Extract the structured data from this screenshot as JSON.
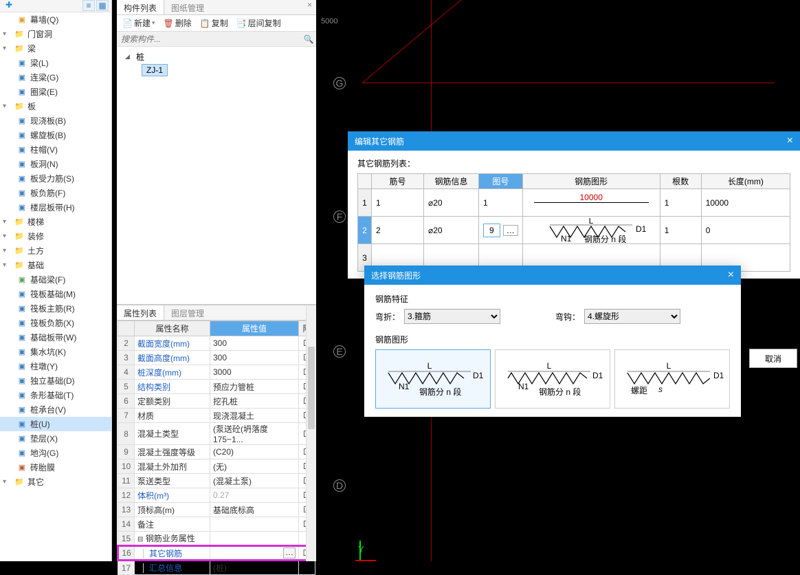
{
  "left_tree": {
    "categories": [
      {
        "label": "幕墙(Q)",
        "indent": "sub",
        "icon": "wall",
        "color": "#e0a030"
      },
      {
        "label": "门窗洞",
        "indent": "top",
        "icon": "folder"
      },
      {
        "label": "梁",
        "indent": "top",
        "icon": "folder"
      },
      {
        "label": "梁(L)",
        "indent": "sub",
        "icon": "beam",
        "color": "#4080c0"
      },
      {
        "label": "连梁(G)",
        "indent": "sub",
        "icon": "beam",
        "color": "#4080c0"
      },
      {
        "label": "圈梁(E)",
        "indent": "sub",
        "icon": "beam",
        "color": "#4080c0"
      },
      {
        "label": "板",
        "indent": "top",
        "icon": "folder"
      },
      {
        "label": "现浇板(B)",
        "indent": "sub",
        "icon": "slab",
        "color": "#4080c0"
      },
      {
        "label": "螺旋板(B)",
        "indent": "sub",
        "icon": "slab",
        "color": "#4080c0"
      },
      {
        "label": "柱帽(V)",
        "indent": "sub",
        "icon": "cap",
        "color": "#4080c0"
      },
      {
        "label": "板洞(N)",
        "indent": "sub",
        "icon": "hole",
        "color": "#4080c0"
      },
      {
        "label": "板受力筋(S)",
        "indent": "sub",
        "icon": "rebar",
        "color": "#4080c0"
      },
      {
        "label": "板负筋(F)",
        "indent": "sub",
        "icon": "rebar",
        "color": "#4080c0"
      },
      {
        "label": "楼层板带(H)",
        "indent": "sub",
        "icon": "strip",
        "color": "#4080c0"
      },
      {
        "label": "楼梯",
        "indent": "top",
        "icon": "folder"
      },
      {
        "label": "装修",
        "indent": "top",
        "icon": "folder"
      },
      {
        "label": "土方",
        "indent": "top",
        "icon": "folder"
      },
      {
        "label": "基础",
        "indent": "top",
        "icon": "folder"
      },
      {
        "label": "基础梁(F)",
        "indent": "sub",
        "icon": "fbeam",
        "color": "#60a060"
      },
      {
        "label": "筏板基础(M)",
        "indent": "sub",
        "icon": "raft",
        "color": "#4080c0"
      },
      {
        "label": "筏板主筋(R)",
        "indent": "sub",
        "icon": "rebar",
        "color": "#4080c0"
      },
      {
        "label": "筏板负筋(X)",
        "indent": "sub",
        "icon": "rebar",
        "color": "#4080c0"
      },
      {
        "label": "基础板带(W)",
        "indent": "sub",
        "icon": "strip",
        "color": "#4080c0"
      },
      {
        "label": "集水坑(K)",
        "indent": "sub",
        "icon": "sump",
        "color": "#4080c0"
      },
      {
        "label": "柱墩(Y)",
        "indent": "sub",
        "icon": "pier",
        "color": "#4080c0"
      },
      {
        "label": "独立基础(D)",
        "indent": "sub",
        "icon": "iso",
        "color": "#4080c0"
      },
      {
        "label": "条形基础(T)",
        "indent": "sub",
        "icon": "strip2",
        "color": "#4080c0"
      },
      {
        "label": "桩承台(V)",
        "indent": "sub",
        "icon": "cap2",
        "color": "#4080c0"
      },
      {
        "label": "桩(U)",
        "indent": "sub",
        "icon": "pile",
        "color": "#4080c0",
        "selected": true
      },
      {
        "label": "垫层(X)",
        "indent": "sub",
        "icon": "bed",
        "color": "#4080c0"
      },
      {
        "label": "地沟(G)",
        "indent": "sub",
        "icon": "trench",
        "color": "#4080c0"
      },
      {
        "label": "砖胎膜",
        "indent": "sub",
        "icon": "brick",
        "color": "#c06030"
      },
      {
        "label": "其它",
        "indent": "top",
        "icon": "folder"
      }
    ]
  },
  "component_panel": {
    "tabs": [
      "构件列表",
      "图纸管理"
    ],
    "toolbar": {
      "new": "新建",
      "delete": "删除",
      "copy": "复制",
      "layer_copy": "层间复制"
    },
    "search_placeholder": "搜索构件...",
    "tree": [
      {
        "label": "桩",
        "level": 0
      },
      {
        "label": "ZJ-1",
        "level": 1,
        "selected": true
      }
    ]
  },
  "property_panel": {
    "tabs": [
      "属性列表",
      "图层管理"
    ],
    "headers": {
      "name": "属性名称",
      "value": "属性值",
      "extra": "附"
    },
    "rows": [
      {
        "n": "2",
        "name": "截面宽度(mm)",
        "value": "300",
        "link": true
      },
      {
        "n": "3",
        "name": "截面高度(mm)",
        "value": "300",
        "link": true
      },
      {
        "n": "4",
        "name": "桩深度(mm)",
        "value": "3000",
        "link": true
      },
      {
        "n": "5",
        "name": "结构类别",
        "value": "预应力管桩",
        "link": true
      },
      {
        "n": "6",
        "name": "定额类别",
        "value": "挖孔桩"
      },
      {
        "n": "7",
        "name": "材质",
        "value": "现浇混凝土"
      },
      {
        "n": "8",
        "name": "混凝土类型",
        "value": "(泵送砼(坍落度175~1..."
      },
      {
        "n": "9",
        "name": "混凝土强度等级",
        "value": "(C20)"
      },
      {
        "n": "10",
        "name": "混凝土外加剂",
        "value": "(无)"
      },
      {
        "n": "11",
        "name": "泵送类型",
        "value": "(混凝土泵)"
      },
      {
        "n": "12",
        "name": "体积(m³)",
        "value": "0.27",
        "gray": true,
        "link": true
      },
      {
        "n": "13",
        "name": "顶标高(m)",
        "value": "基础底标高"
      },
      {
        "n": "14",
        "name": "备注",
        "value": ""
      },
      {
        "n": "15",
        "name": "钢筋业务属性",
        "value": "",
        "group": true
      },
      {
        "n": "16",
        "name": "其它钢筋",
        "value": "",
        "highlight": true,
        "link": true,
        "ellipsis": true
      },
      {
        "n": "17",
        "name": "汇总信息",
        "value": "(桩)",
        "link": true
      }
    ]
  },
  "canvas": {
    "dim1": "5000",
    "labels": [
      "G",
      "F",
      "E",
      "D"
    ],
    "coord_y": "Y"
  },
  "dlg_edit": {
    "title": "编辑其它钢筋",
    "list_label": "其它钢筋列表：",
    "headers": [
      "筋号",
      "钢筋信息",
      "图号",
      "钢筋图形",
      "根数",
      "长度(mm)"
    ],
    "rows": [
      {
        "n": "1",
        "id": "1",
        "info": "⌀20",
        "shape_no": "1",
        "shape_dim": "10000",
        "count": "1",
        "length": "10000"
      },
      {
        "n": "2",
        "id": "2",
        "info": "⌀20",
        "shape_no": "9",
        "shape_label": "钢筋分 n 段",
        "shape_L": "L",
        "shape_N1": "N1",
        "shape_D1": "D1",
        "count": "1",
        "length": "0",
        "selected": true
      },
      {
        "n": "3",
        "id": "",
        "info": "",
        "shape_no": "",
        "count": "",
        "length": ""
      }
    ]
  },
  "dlg_shape": {
    "title": "选择钢筋图形",
    "section1": "钢筋特征",
    "bend_label": "弯折：",
    "bend_value": "3.箍筋",
    "hook_label": "弯钩：",
    "hook_value": "4.螺旋形",
    "section2": "钢筋图形",
    "cards": [
      {
        "L": "L",
        "N1": "N1",
        "D1": "D1",
        "sub": "钢筋分 n 段",
        "selected": true
      },
      {
        "L": "L",
        "N1": "N1",
        "D1": "D1",
        "sub": "钢筋分 n 段"
      },
      {
        "L": "L",
        "S": "s",
        "D1": "D1",
        "sub": "螺距"
      }
    ],
    "cancel": "取消"
  }
}
